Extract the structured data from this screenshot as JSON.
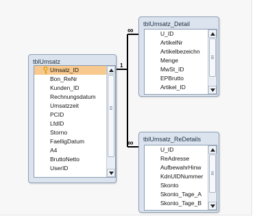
{
  "tables": {
    "umsatz": {
      "title": "tblUmsatz",
      "fields": [
        "Umsatz_ID",
        "Bon_ReNr",
        "Kunden_ID",
        "Rechnungsdatum",
        "Umsatzzeit",
        "PCID",
        "LfdID",
        "Storno",
        "FaelligDatum",
        "A4",
        "BruttoNetto",
        "UserID"
      ],
      "primary_key": "Umsatz_ID"
    },
    "detail": {
      "title": "tblUmsatz_Detail",
      "fields": [
        "U_ID",
        "ArtikelNr",
        "Artikelbezeichn",
        "Menge",
        "MwSt_ID",
        "EPBrutto",
        "Artikel_ID"
      ]
    },
    "redetails": {
      "title": "tblUmsatz_ReDetails",
      "fields": [
        "U_ID",
        "ReAdresse",
        "AufbewahrHinw",
        "KdnUIDNummer",
        "Skonto",
        "Skonto_Tage_A",
        "Skonto_Tage_B"
      ]
    }
  },
  "relationships": {
    "one_label": "1",
    "many_symbol": "∞"
  },
  "colors": {
    "window_bg": "#dbe4ee",
    "selected_row": "#f8c98e",
    "key_icon": "#d8a21b",
    "relation_line": "#000000"
  }
}
